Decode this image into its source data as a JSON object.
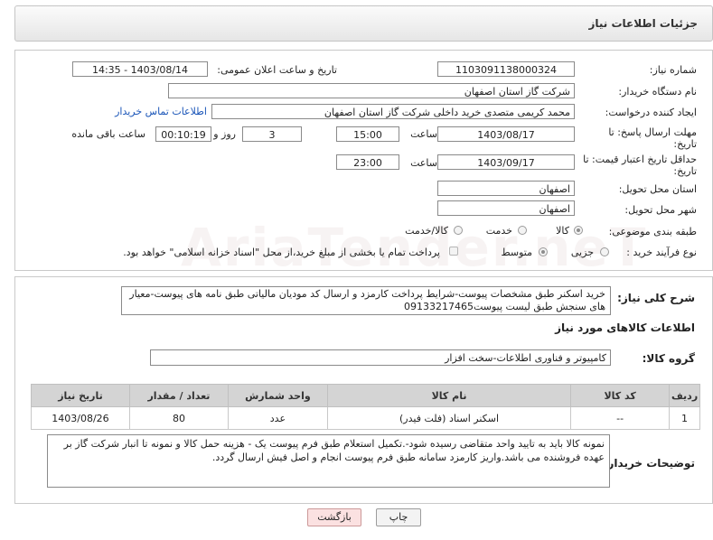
{
  "header": {
    "title": "جزئیات اطلاعات نیاز"
  },
  "need_number": {
    "label": "شماره نیاز:",
    "value": "1103091138000324"
  },
  "announce_datetime": {
    "label": "تاریخ و ساعت اعلان عمومی:",
    "value": "1403/08/14 - 14:35"
  },
  "buyer_org": {
    "label": "نام دستگاه خریدار:",
    "value": "شرکت گاز استان اصفهان"
  },
  "requester": {
    "label": "ایجاد کننده درخواست:",
    "value": "محمد کریمی متصدی خرید داخلی شرکت گاز استان اصفهان",
    "contact_link": "اطلاعات تماس خریدار"
  },
  "reply_deadline": {
    "label": "مهلت ارسال پاسخ: تا",
    "label2": "تاریخ:",
    "date": "1403/08/17",
    "time_label": "ساعت",
    "time": "15:00",
    "days": "3",
    "days_label": "روز و",
    "remaining": "00:10:19",
    "remaining_label": "ساعت باقی مانده"
  },
  "price_validity": {
    "label": "حداقل تاریخ اعتبار قیمت: تا",
    "label2": "تاریخ:",
    "date": "1403/09/17",
    "time_label": "ساعت",
    "time": "23:00"
  },
  "province": {
    "label": "استان محل تحویل:",
    "value": "اصفهان"
  },
  "city": {
    "label": "شهر محل تحویل:",
    "value": "اصفهان"
  },
  "category": {
    "label": "طبقه بندی موضوعی:",
    "options": [
      "کالا",
      "خدمت",
      "کالا/خدمت"
    ],
    "selected": "کالا"
  },
  "purchase_type": {
    "label": "نوع فرآیند خرید :",
    "options": [
      "جزیی",
      "متوسط"
    ],
    "selected": "متوسط",
    "payment_note": "پرداخت تمام یا بخشی از مبلغ خرید،از محل \"اسناد خزانه اسلامی\" خواهد بود."
  },
  "general_desc": {
    "label": "شرح کلی نیاز:",
    "value": "خرید اسکنر طبق مشخصات پیوست-شرایط پرداخت کارمزد و ارسال کد مودیان مالیاتی طبق نامه های پیوست-معیار های سنجش طبق لیست پیوست09133217465"
  },
  "goods_info": {
    "title": "اطلاعات کالاهای مورد نیاز"
  },
  "goods_group": {
    "label": "گروه کالا:",
    "value": "کامپیوتر و فناوری اطلاعات-سخت افزار"
  },
  "table": {
    "headers": [
      "ردیف",
      "کد کالا",
      "نام کالا",
      "واحد شمارش",
      "تعداد / مقدار",
      "تاریخ نیاز"
    ],
    "rows": [
      [
        "1",
        "--",
        "اسکنر اسناد (فلت فیدر)",
        "عدد",
        "80",
        "1403/08/26"
      ]
    ]
  },
  "buyer_notes": {
    "label": "توضیحات خریدار:",
    "value": "نمونه کالا باید به تایید واحد متقاضی رسیده شود-.تکمیل استعلام طبق فرم پیوست یک - هزینه حمل کالا و نمونه تا انبار شرکت گاز بر عهده فروشنده می باشد.واریز کارمزد سامانه طبق فرم پیوست انجام و اصل فیش ارسال گردد."
  },
  "buttons": {
    "print": "چاپ",
    "back": "بازگشت"
  },
  "watermark": "AriaTender.neT"
}
